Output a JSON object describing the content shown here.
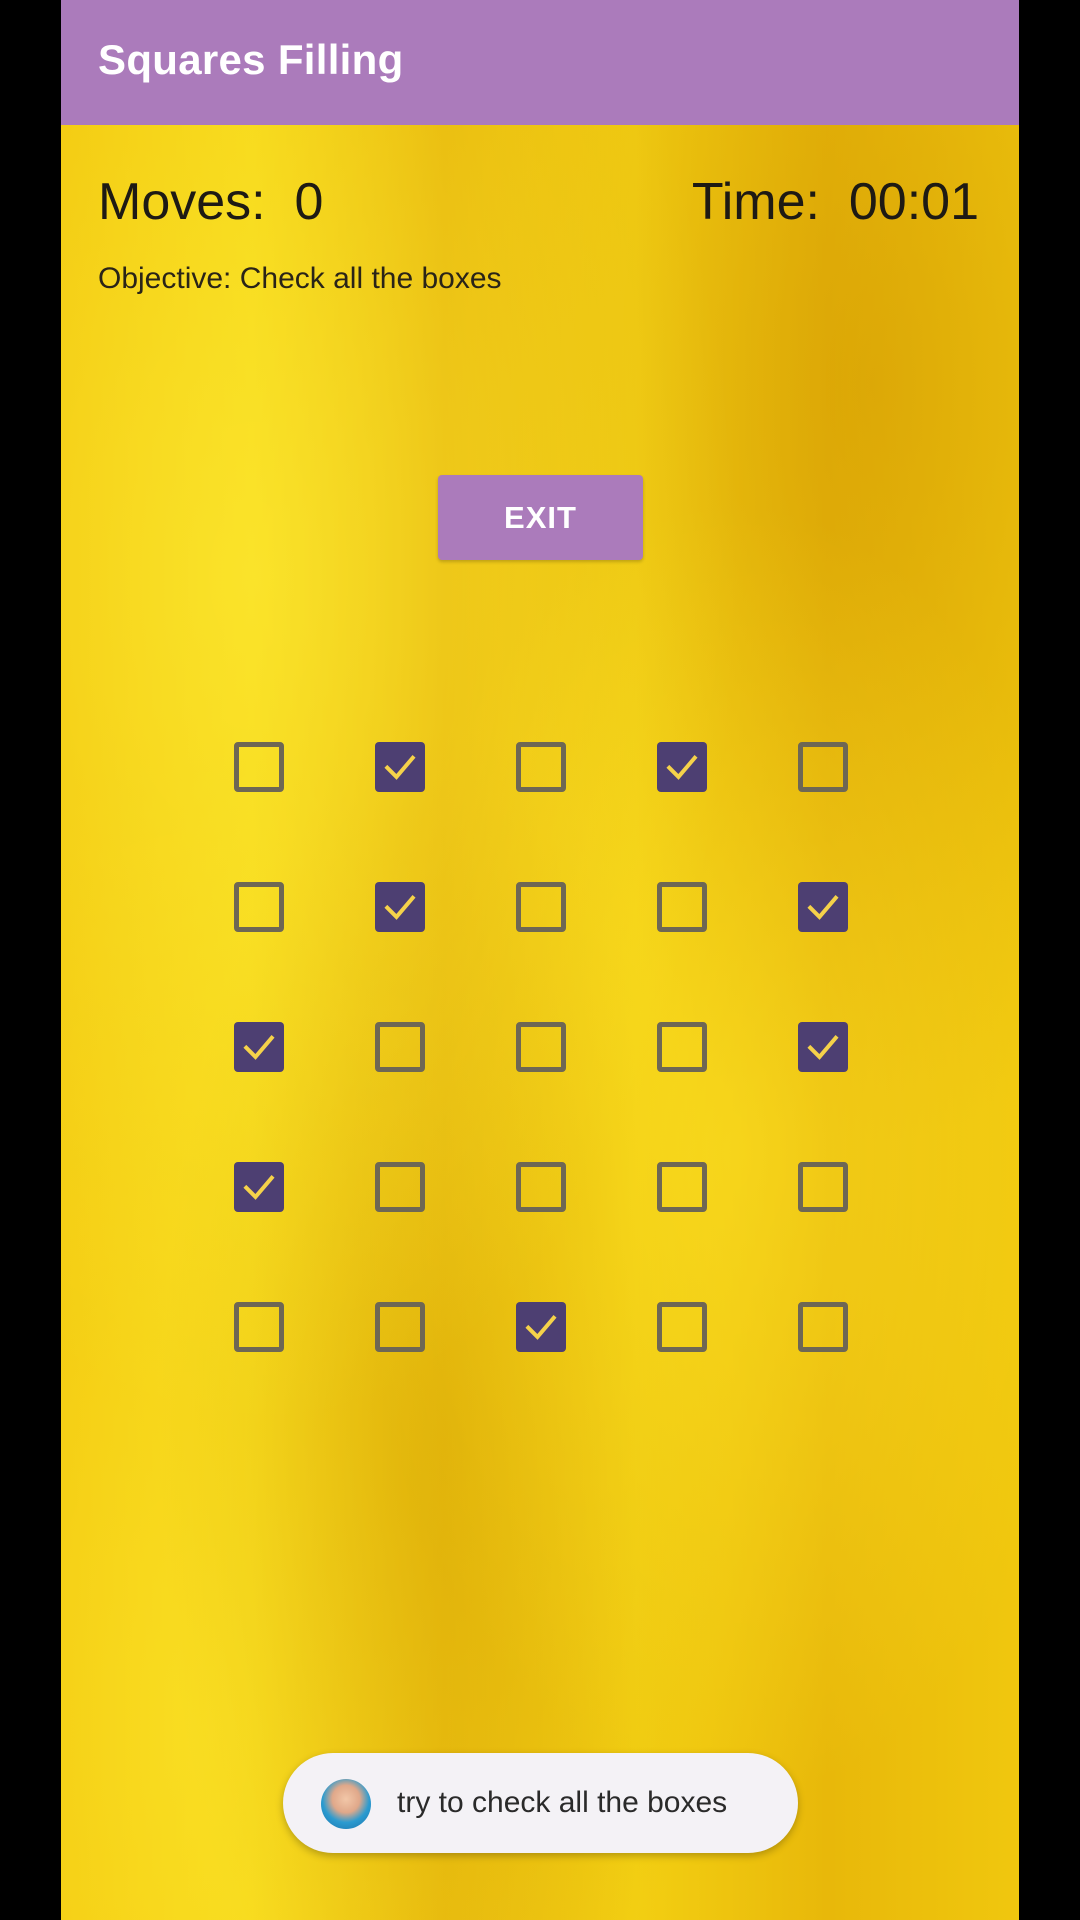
{
  "app": {
    "title": "Squares Filling"
  },
  "stats": {
    "moves_label": "Moves:  0",
    "time_label": "Time:  00:01"
  },
  "objective": "Objective: Check all the boxes",
  "exit_button": "EXIT",
  "board": {
    "rows": 5,
    "cols": 5,
    "checked": [
      [
        false,
        true,
        false,
        true,
        false
      ],
      [
        false,
        true,
        false,
        false,
        true
      ],
      [
        true,
        false,
        false,
        false,
        true
      ],
      [
        true,
        false,
        false,
        false,
        false
      ],
      [
        false,
        false,
        true,
        false,
        false
      ]
    ]
  },
  "toast": {
    "text": "try to check all the boxes",
    "icon": "avatar-icon"
  },
  "colors": {
    "appbar": "#ab7bbb",
    "checkbox_checked": "#4d3f72",
    "checkmark": "#f5d24a",
    "checkbox_border": "#6e6754"
  }
}
